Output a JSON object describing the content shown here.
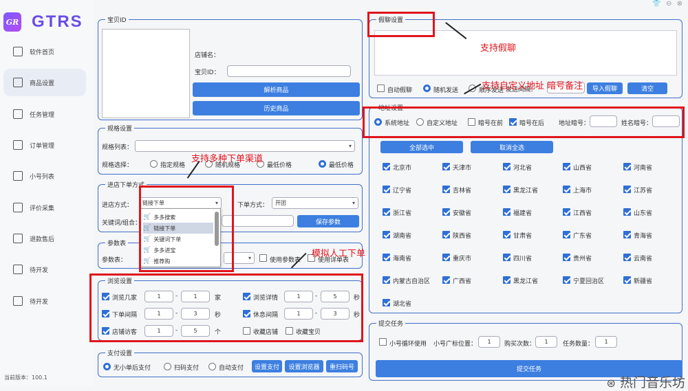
{
  "app": {
    "logo_mark": "GR",
    "name": "GTRS",
    "version": "当前版本：100.1"
  },
  "nav": [
    {
      "label": "软件首页",
      "icon": "home-icon",
      "active": false
    },
    {
      "label": "商品设置",
      "icon": "goods-icon",
      "active": true
    },
    {
      "label": "任务管理",
      "icon": "task-icon",
      "active": false
    },
    {
      "label": "订单管理",
      "icon": "order-icon",
      "active": false
    },
    {
      "label": "小号列表",
      "icon": "account-icon",
      "active": false
    },
    {
      "label": "评价采集",
      "icon": "review-icon",
      "active": false
    },
    {
      "label": "退款售后",
      "icon": "refund-icon",
      "active": false
    },
    {
      "label": "待开发",
      "icon": "dev-icon",
      "active": false
    },
    {
      "label": "待开发",
      "icon": "dev-icon",
      "active": false
    }
  ],
  "goods": {
    "legend": "宝贝ID",
    "shop_label": "店铺名：",
    "id_label": "宝贝ID：",
    "id_value": "",
    "parse_btn": "解析商品",
    "history_btn": "历史商品"
  },
  "spec": {
    "legend": "规格设置",
    "list_label": "规格列表：",
    "list_value": "",
    "choose_label": "规格选择：",
    "options": [
      {
        "label": "指定规格",
        "on": false
      },
      {
        "label": "随机规格",
        "on": false
      },
      {
        "label": "最低价格",
        "on": false
      },
      {
        "label": "最低价格",
        "on": true
      }
    ]
  },
  "order": {
    "legend": "进店下单方式",
    "enter_label": "进店方式：",
    "enter_value": "链接下单",
    "order_label": "下单方式：",
    "order_value": "开团",
    "keyword_label": "关键词/组合：",
    "keyword_value": "",
    "save_btn": "保存参数",
    "dropdown": [
      {
        "label": "多多搜索",
        "hl": false
      },
      {
        "label": "链接下单",
        "hl": true
      },
      {
        "label": "关键词下单",
        "hl": false
      },
      {
        "label": "多多进宝",
        "hl": false
      },
      {
        "label": "推荐购",
        "hl": false
      }
    ]
  },
  "params": {
    "legend": "参数表",
    "label": "参数表：",
    "opt1": "使用参数表",
    "opt2": "使用详单表"
  },
  "browse": {
    "legend": "浏览设置",
    "rows": [
      {
        "label": "浏览几家",
        "on": true,
        "a": "1",
        "b": "1",
        "unit": "家",
        "label2": "浏览详情",
        "on2": true,
        "a2": "1",
        "b2": "5",
        "unit2": "秒"
      },
      {
        "label": "下单间隔",
        "on": true,
        "a": "1",
        "b": "3",
        "unit": "秒",
        "label2": "休息间隔",
        "on2": true,
        "a2": "1",
        "b2": "3",
        "unit2": "秒"
      },
      {
        "label": "店铺访客",
        "on": true,
        "a": "1",
        "b": "5",
        "unit": "个",
        "label2": "收藏店铺",
        "on2": false,
        "label3": "收藏宝贝",
        "on3": false
      }
    ]
  },
  "pay": {
    "legend": "支付设置",
    "opts": [
      {
        "label": "无小单后支付",
        "on": true
      },
      {
        "label": "扫码支付",
        "on": false
      },
      {
        "label": "自动支付",
        "on": false
      }
    ],
    "btns": [
      "设置支付",
      "设置浏览器",
      "重扫码号"
    ]
  },
  "chat": {
    "legend": "假聊设置",
    "opts": [
      {
        "label": "自动假聊",
        "type": "cb",
        "on": false
      },
      {
        "label": "随机发送",
        "type": "rd",
        "on": true
      },
      {
        "label": "顺序发送",
        "type": "rd",
        "on": false
      }
    ],
    "interval_label": "发送间隔：",
    "import_btn": "导入假聊",
    "clear_btn": "清空"
  },
  "addr": {
    "legend": "地址设置",
    "opts": [
      {
        "label": "系统地址",
        "type": "rd",
        "on": true
      },
      {
        "label": "自定义地址",
        "type": "rd",
        "on": false
      },
      {
        "label": "暗号在前",
        "type": "cb",
        "on": false
      },
      {
        "label": "暗号在后",
        "type": "cb",
        "on": true
      }
    ],
    "addr_code_label": "地址暗号：",
    "name_code_label": "姓名暗号：",
    "select_all": "全部选中",
    "clear_all": "取消全选",
    "provinces": [
      "北京市",
      "天津市",
      "河北省",
      "山西省",
      "河南省",
      "辽宁省",
      "吉林省",
      "黑龙江省",
      "上海市",
      "江苏省",
      "浙江省",
      "安徽省",
      "福建省",
      "江西省",
      "山东省",
      "湖南省",
      "陕西省",
      "甘肃省",
      "广东省",
      "青海省",
      "海南省",
      "重庆市",
      "四川省",
      "贵州省",
      "云南省",
      "内蒙古自治区",
      "广西省",
      "黑龙江省",
      "宁夏回治区",
      "新疆省",
      "湖北省"
    ]
  },
  "submit": {
    "legend": "提交任务",
    "loop_label": "小号循环使用",
    "tag_label": "小号广标位置：",
    "tag_value": "1",
    "times_label": "购买次数：",
    "times_value": "1",
    "count_label": "任务数量：",
    "count_value": "1",
    "submit_btn": "提交任务"
  },
  "annotations": {
    "chat": "支持假聊",
    "addr": "支持自定义地址 暗号备注",
    "channels": "支持多种下单渠道",
    "human": "模拟人工下单"
  },
  "watermark": "热门音乐坊"
}
